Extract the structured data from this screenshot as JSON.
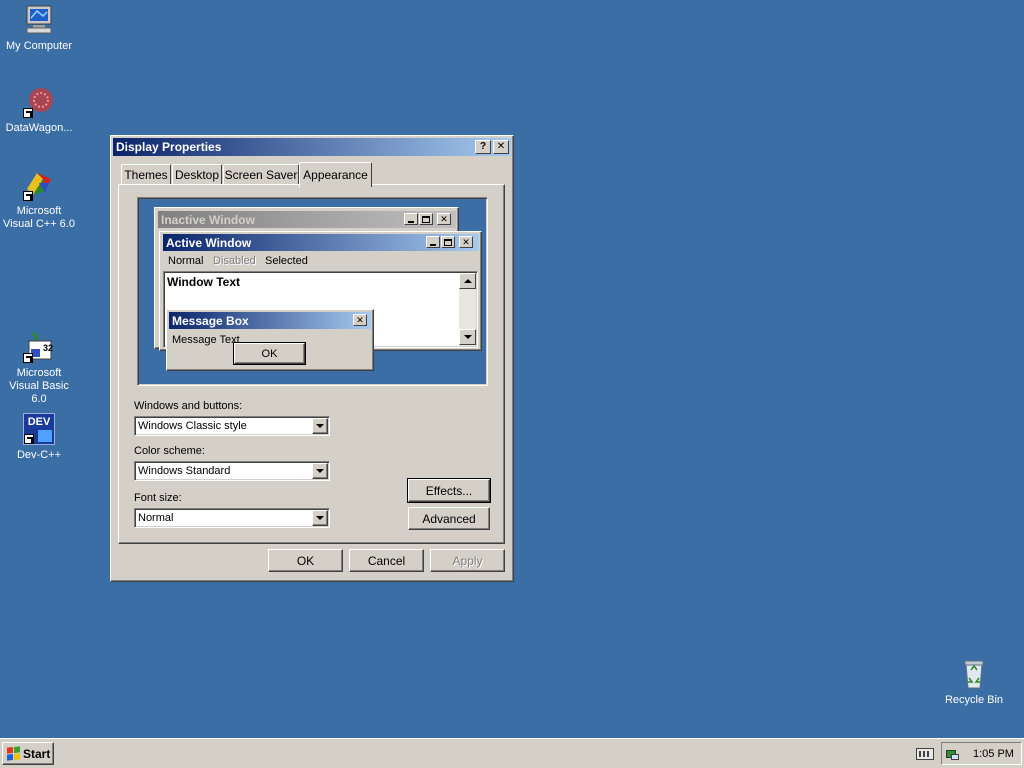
{
  "desktop": {
    "icons": [
      {
        "label": "My Computer",
        "icon": "my-computer-icon"
      },
      {
        "label": "DataWagon...",
        "icon": "datawagon-icon"
      },
      {
        "label": "Microsoft Visual C++ 6.0",
        "icon": "visual-cpp-icon"
      },
      {
        "label": "Microsoft Visual Basic 6.0",
        "icon": "visual-basic-icon"
      },
      {
        "label": "Dev-C++",
        "icon": "dev-cpp-icon"
      },
      {
        "label": "Recycle Bin",
        "icon": "recycle-bin-icon"
      }
    ],
    "background_color": "#3a6ea5",
    "dev_icon_text": "DEV"
  },
  "dialog": {
    "title": "Display Properties",
    "help_glyph": "?",
    "close_glyph": "✕",
    "tabs": [
      {
        "label": "Themes"
      },
      {
        "label": "Desktop"
      },
      {
        "label": "Screen Saver"
      },
      {
        "label": "Appearance",
        "selected": true
      }
    ],
    "preview": {
      "inactive_title": "Inactive Window",
      "active_title": "Active Window",
      "menu": {
        "normal": "Normal",
        "disabled": "Disabled",
        "selected": "Selected"
      },
      "window_text": "Window Text",
      "message_box_title": "Message Box",
      "message_text": "Message Text",
      "ok_label": "OK"
    },
    "windows_and_buttons": {
      "label": "Windows and buttons:",
      "value": "Windows Classic style"
    },
    "color_scheme": {
      "label": "Color scheme:",
      "value": "Windows Standard"
    },
    "font_size": {
      "label": "Font size:",
      "value": "Normal"
    },
    "effects_label": "Effects...",
    "advanced_label": "Advanced",
    "ok_label": "OK",
    "cancel_label": "Cancel",
    "apply_label": "Apply",
    "apply_enabled": false
  },
  "taskbar": {
    "start_label": "Start",
    "clock": "1:05 PM"
  },
  "colors": {
    "desktop": "#3a6ea5",
    "active_title_start": "#0a246a",
    "active_title_end": "#a6caf0",
    "face": "#d4d0c8"
  }
}
